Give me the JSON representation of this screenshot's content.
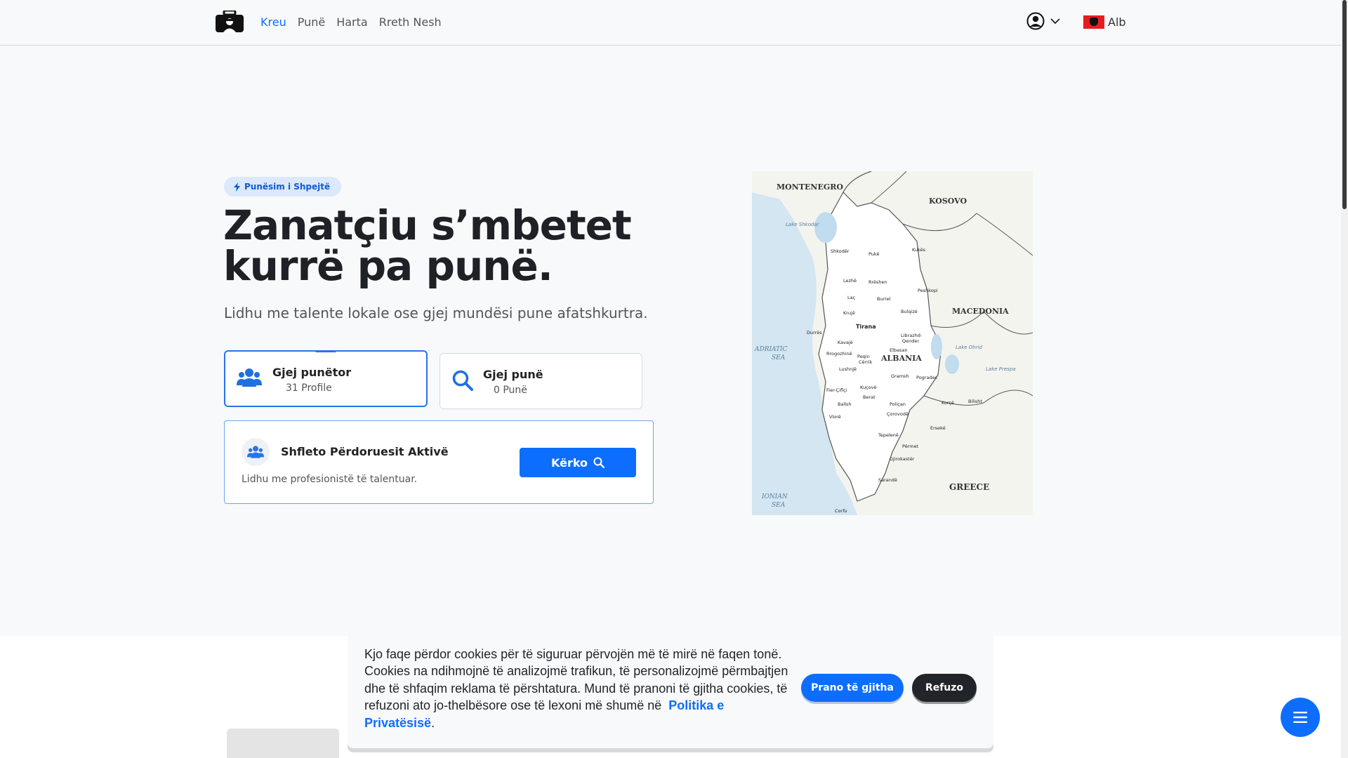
{
  "nav": {
    "items": [
      {
        "label": "Kreu",
        "active": true
      },
      {
        "label": "Punë",
        "active": false
      },
      {
        "label": "Harta",
        "active": false
      },
      {
        "label": "Rreth Nesh",
        "active": false
      }
    ],
    "user_icon": "user-circle-icon",
    "lang_label": "Alb"
  },
  "hero": {
    "badge": "Punësim i Shpejtë",
    "title": "Zanatçiu s’mbetet kurrë pa punë.",
    "subtitle": "Lidhu me talente lokale ose gjej mundësi pune afatshkurtra."
  },
  "cards": {
    "workers": {
      "title": "Gjej punëtor",
      "sub": "31 Profile"
    },
    "jobs": {
      "title": "Gjej punë",
      "sub": "0 Punë"
    }
  },
  "browse": {
    "title": "Shfleto Përdoruesit Aktivë",
    "desc": "Lidhu me profesionistë të talentuar.",
    "button": "Kërko"
  },
  "map": {
    "countries": [
      "MONTENEGRO",
      "KOSOVO",
      "MACEDONIA",
      "ALBANIA",
      "GREECE"
    ],
    "seas": [
      "ADRIATIC",
      "SEA",
      "IONIAN",
      "SEA"
    ],
    "lakes": [
      "Lake Shkodar",
      "Lake Ohrid",
      "Lake Prespa"
    ],
    "capital": "Tirana",
    "cities": [
      "Shkodër",
      "Pukë",
      "Kukës",
      "Lezhë",
      "Rrëshen",
      "Laç",
      "Burrel",
      "Peshkopi",
      "Krujë",
      "Bulqizë",
      "Durrës",
      "Kavajë",
      "Librazhd-Qender",
      "Elbasan",
      "Rrogozhinë",
      "Peqin",
      "Cërrik",
      "Lushnjë",
      "Gramsh",
      "Pogradec",
      "Fier-Çiflçi",
      "Kuçovë",
      "Ballsh",
      "Berat",
      "Korçë",
      "Bilisht",
      "Poliçan",
      "Vlorë",
      "Çorovodë",
      "Ersekë",
      "Tepelenë",
      "Përmet",
      "Gjirokastër",
      "Sarandë",
      "Corfu"
    ],
    "colors": {
      "sea": "#d3e6f2",
      "land": "#f4f4ef",
      "albania": "#ffffff",
      "border": "#555555"
    }
  },
  "cookie": {
    "text": "Kjo faqe përdor cookies për të siguruar përvojën më të mirë në faqen tonë. Cookies na ndihmojnë të analizojmë trafikun, të personalizojmë përmbajtjen dhe të shfaqim reklama të përshtatura. Mund të pranoni të gjitha cookies, të refuzoni ato jo-thelbësore ose të lexoni më shumë në",
    "link": "Politika e Privatësisë",
    "after": ".",
    "accept": "Prano të gjitha",
    "reject": "Refuzo"
  },
  "colors": {
    "accent": "#0d6efd",
    "dark": "#212529"
  }
}
